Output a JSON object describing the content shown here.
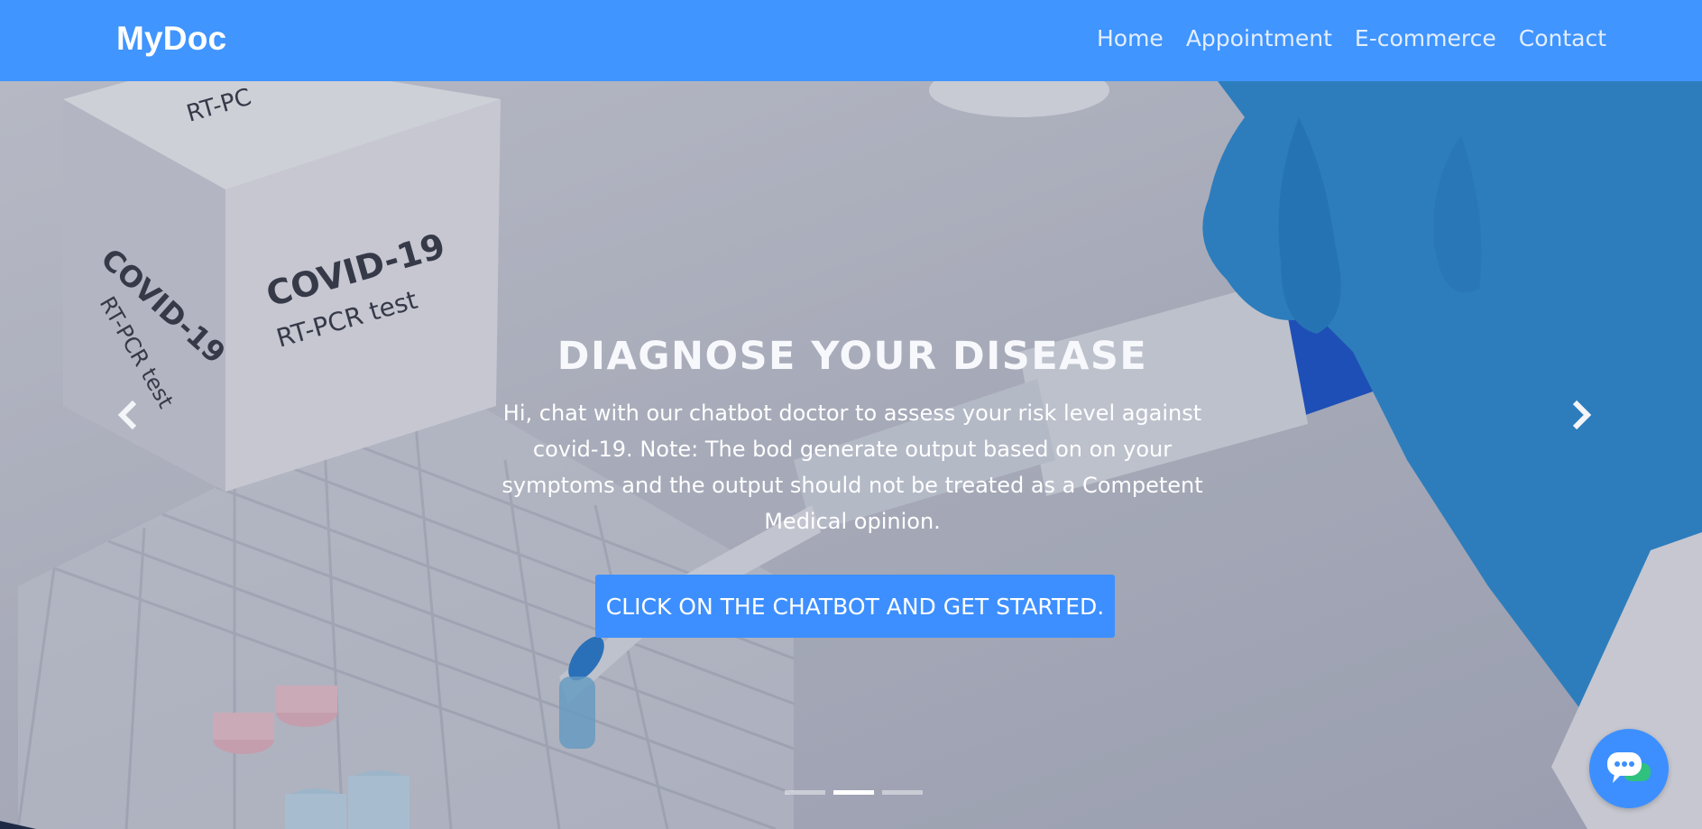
{
  "navbar": {
    "brand": "MyDoc",
    "links": [
      "Home",
      "Appointment",
      "E-commerce",
      "Contact"
    ]
  },
  "hero": {
    "title": "DIAGNOSE YOUR DISEASE",
    "description": "Hi, chat with our chatbot doctor to assess your risk level against covid-19. Note: The bod generate output based on on your symptoms and the output should not be treated as a Competent Medical opinion.",
    "cta_label": "CLICK ON THE CHATBOT AND GET STARTED.",
    "box_text_1": "COVID-19",
    "box_text_2": "RT-PCR test",
    "box_top_text": "RT-PC",
    "active_slide": 2,
    "slide_count": 3
  },
  "colors": {
    "navbar": "#4095ff",
    "accent": "#3d8fff",
    "glove": "#2f8fd6"
  },
  "icons": {
    "prev": "chevron-left-icon",
    "next": "chevron-right-icon",
    "chat": "chat-bubble-icon"
  }
}
